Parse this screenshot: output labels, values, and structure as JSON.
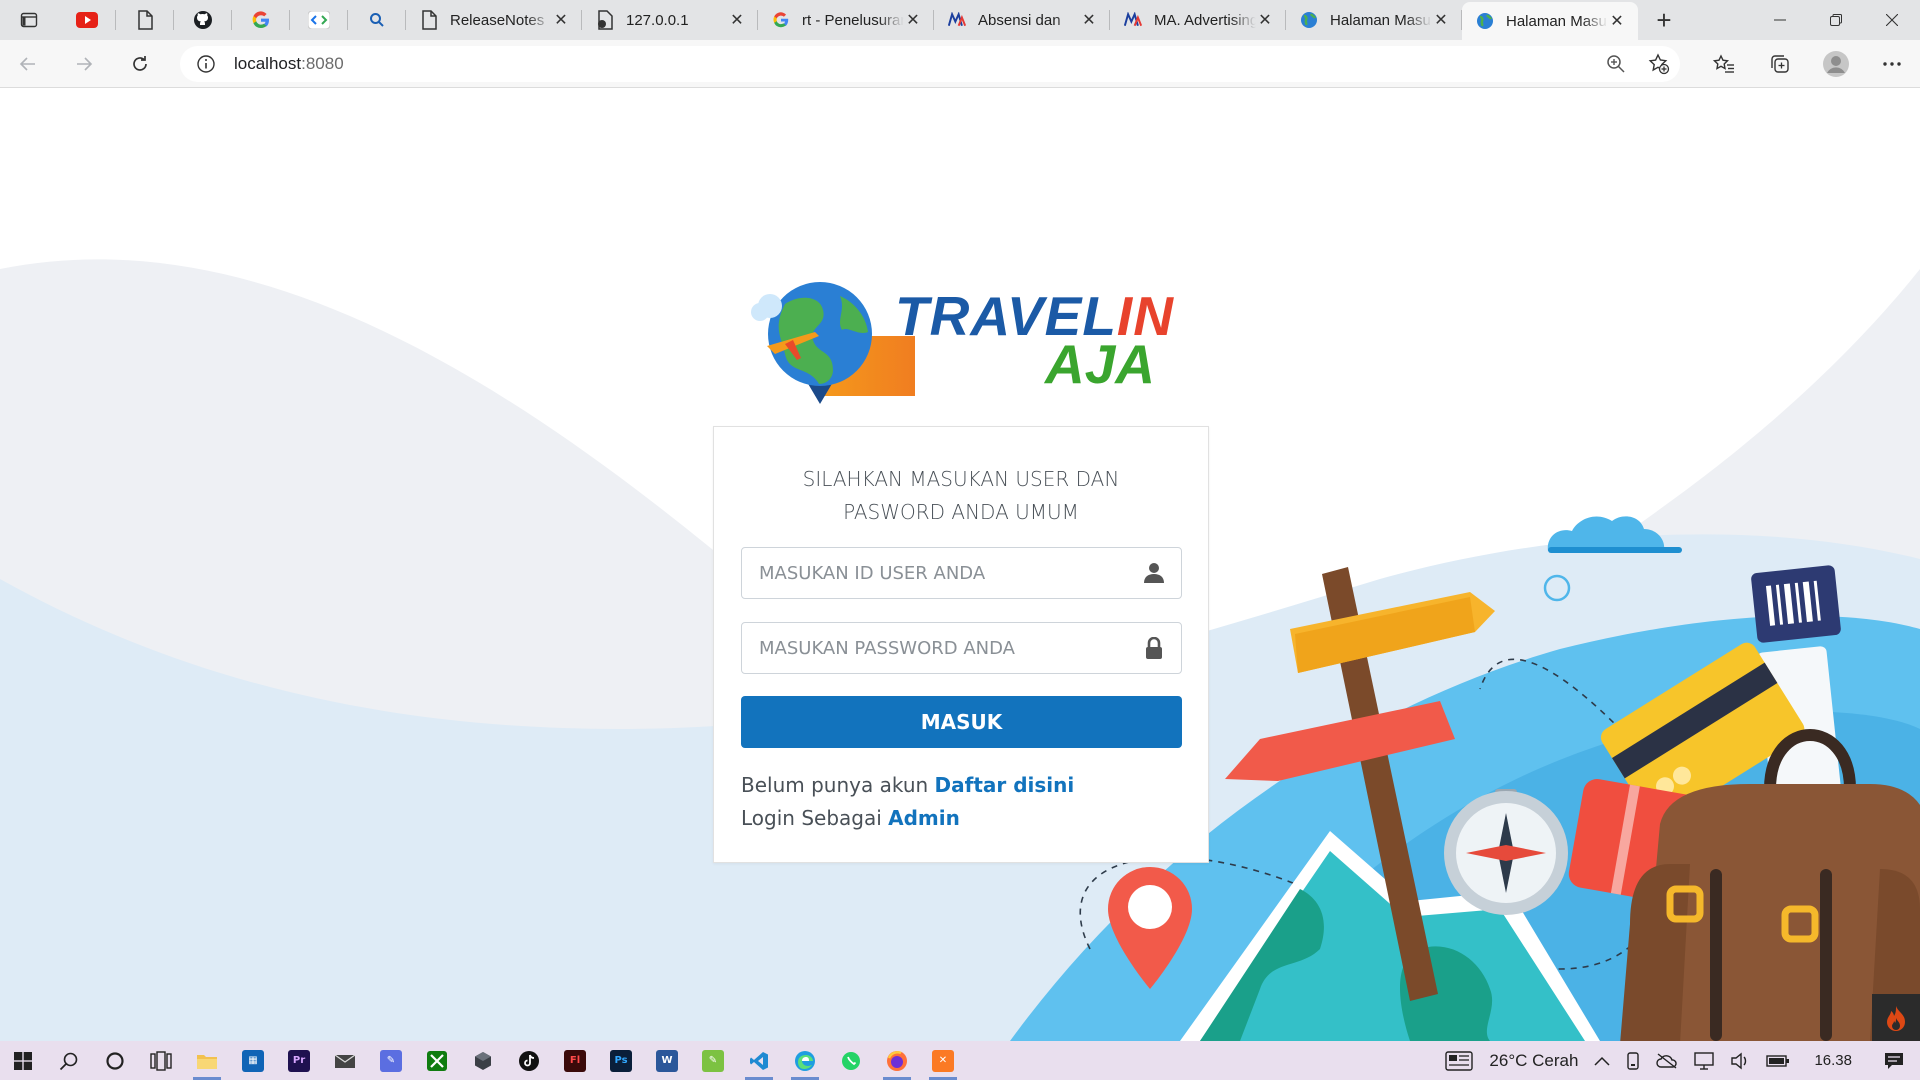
{
  "browser": {
    "tabs": [
      {
        "title": "ReleaseNotes",
        "icon": "document-icon"
      },
      {
        "title": "127.0.0.1",
        "icon": "lock-document-icon"
      },
      {
        "title": "rt - Penelusuran",
        "icon": "google-icon"
      },
      {
        "title": "Absensi dan",
        "icon": "ma-icon"
      },
      {
        "title": "MA. Advertising",
        "icon": "ma-icon"
      },
      {
        "title": "Halaman Masuk",
        "icon": "globe-icon"
      },
      {
        "title": "Halaman Masuk",
        "icon": "globe-icon"
      }
    ],
    "url_host": "localhost",
    "url_port": ":8080"
  },
  "logo": {
    "line1_part1": "TRAVEL",
    "line1_part2": "IN",
    "line2": "AJA"
  },
  "login": {
    "heading_line1": "SILAHKAN MASUKAN USER DAN",
    "heading_line2": "PASWORD ANDA UMUM",
    "user_placeholder": "MASUKAN ID USER ANDA",
    "password_placeholder": "MASUKAN PASSWORD ANDA",
    "submit_label": "MASUK",
    "register_prompt": "Belum punya akun",
    "register_link": "Daftar disini",
    "admin_prompt": "Login Sebagai",
    "admin_link": "Admin"
  },
  "taskbar": {
    "weather": "26°C",
    "weather_desc": "Cerah",
    "time": "16.38"
  },
  "colors": {
    "primary": "#1273bd",
    "logo_blue": "#1b5aa6",
    "logo_red": "#e8432d",
    "logo_green": "#3aa52e",
    "taskbar": "#e9dfee"
  }
}
